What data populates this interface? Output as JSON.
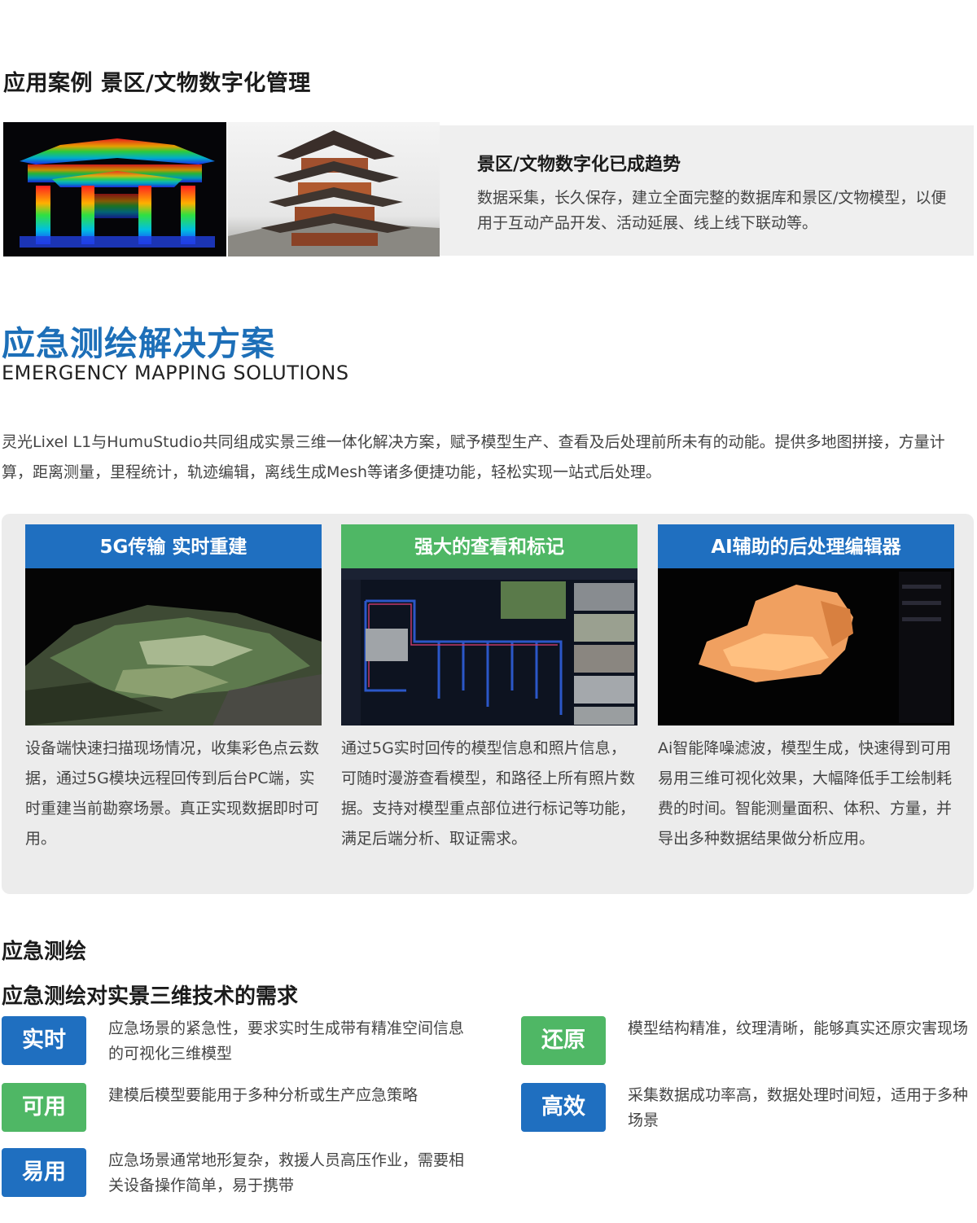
{
  "case": {
    "title": "应用案例  景区/文物数字化管理",
    "panel_title": "景区/文物数字化已成趋势",
    "panel_text": "数据采集，长久保存，建立全面完整的数据库和景区/文物模型，以便用于互动产品开发、活动延展、线上线下联动等。"
  },
  "section": {
    "title": "应急测绘解决方案",
    "subtitle": "EMERGENCY MAPPING SOLUTIONS",
    "intro": "灵光Lixel  L1与HumuStudio共同组成实景三维一体化解决方案，赋予模型生产、查看及后处理前所未有的动能。提供多地图拼接，方量计算，距离测量，里程统计，轨迹编辑，离线生成Mesh等诸多便捷功能，轻松实现一站式后处理。"
  },
  "features": [
    {
      "title": "5G传输 实时重建",
      "color": "#1f6fc0",
      "text": "设备端快速扫描现场情况，收集彩色点云数据，通过5G模块远程回传到后台PC端，实时重建当前勘察场景。真正实现数据即时可用。"
    },
    {
      "title": "强大的查看和标记",
      "color": "#4fb765",
      "text": "通过5G实时回传的模型信息和照片信息，可随时漫游查看模型，和路径上所有照片数据。支持对模型重点部位进行标记等功能，满足后端分析、取证需求。"
    },
    {
      "title": "AI辅助的后处理编辑器",
      "color": "#1f6fc0",
      "text": "Ai智能降噪滤波，模型生成，快速得到可用易用三维可视化效果，大幅降低手工绘制耗费的时间。智能测量面积、体积、方量，并导出多种数据结果做分析应用。"
    }
  ],
  "emergency": {
    "title": "应急测绘",
    "subtitle": "应急测绘对实景三维技术的需求",
    "requirements": [
      {
        "label": "实时",
        "color": "#1f6fc0",
        "text": "应急场景的紧急性，要求实时生成带有精准空间信息的可视化三维模型"
      },
      {
        "label": "可用",
        "color": "#4fb765",
        "text": "建模后模型要能用于多种分析或生产应急策略"
      },
      {
        "label": "易用",
        "color": "#1f6fc0",
        "text": "应急场景通常地形复杂，救援人员高压作业，需要相关设备操作简单，易于携带"
      },
      {
        "label": "还原",
        "color": "#4fb765",
        "text": "模型结构精准，纹理清晰，能够真实还原灾害现场"
      },
      {
        "label": "高效",
        "color": "#1f6fc0",
        "text": "采集数据成功率高，数据处理时间短，适用于多种场景"
      }
    ]
  }
}
